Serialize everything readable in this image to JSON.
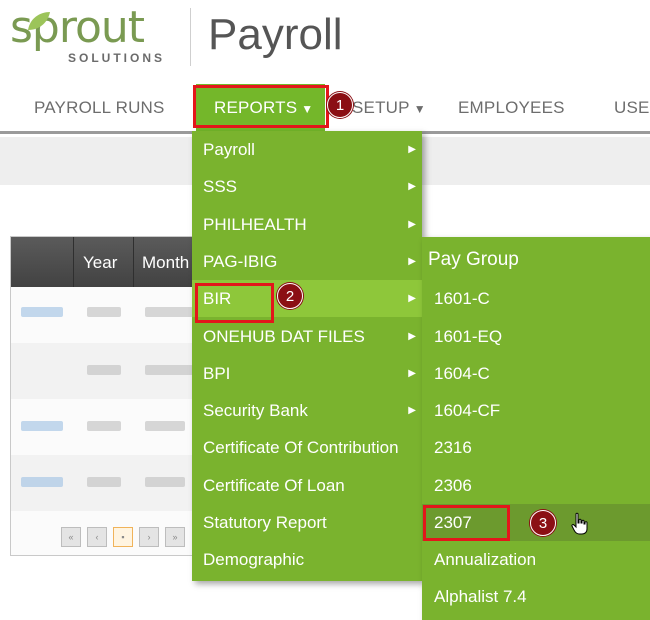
{
  "header": {
    "logo_word": "sprout",
    "logo_sub": "SOLUTIONS",
    "app_title": "Payroll"
  },
  "nav": {
    "items": [
      {
        "label": "PAYROLL RUNS"
      },
      {
        "label": "REPORTS"
      },
      {
        "label": "SETUP"
      },
      {
        "label": "EMPLOYEES"
      },
      {
        "label": "USE"
      }
    ]
  },
  "table": {
    "columns": [
      "Year",
      "Month"
    ]
  },
  "menu": {
    "items": [
      {
        "label": "Payroll",
        "has_submenu": true
      },
      {
        "label": "SSS",
        "has_submenu": true
      },
      {
        "label": "PHILHEALTH",
        "has_submenu": true
      },
      {
        "label": "PAG-IBIG",
        "has_submenu": true
      },
      {
        "label": "BIR",
        "has_submenu": true,
        "active": true
      },
      {
        "label": "ONEHUB DAT FILES",
        "has_submenu": true
      },
      {
        "label": "BPI",
        "has_submenu": true
      },
      {
        "label": "Security Bank",
        "has_submenu": true
      },
      {
        "label": "Certificate Of Contribution",
        "has_submenu": false
      },
      {
        "label": "Certificate Of Loan",
        "has_submenu": false
      },
      {
        "label": "Statutory Report",
        "has_submenu": false
      },
      {
        "label": "Demographic",
        "has_submenu": false
      }
    ]
  },
  "submenu": {
    "header": "Pay Group",
    "items": [
      {
        "label": "1601-C"
      },
      {
        "label": "1601-EQ"
      },
      {
        "label": "1604-C"
      },
      {
        "label": "1604-CF"
      },
      {
        "label": "2316"
      },
      {
        "label": "2306"
      },
      {
        "label": "2307",
        "active": true
      },
      {
        "label": "Annualization"
      },
      {
        "label": "Alphalist 7.4"
      }
    ]
  },
  "annotations": {
    "steps": [
      "1",
      "2",
      "3"
    ],
    "highlight_color": "#e3161b",
    "badge_color": "#8b0f14"
  },
  "colors": {
    "menu_green": "#7ab32e",
    "accent_green": "#74b72a"
  }
}
